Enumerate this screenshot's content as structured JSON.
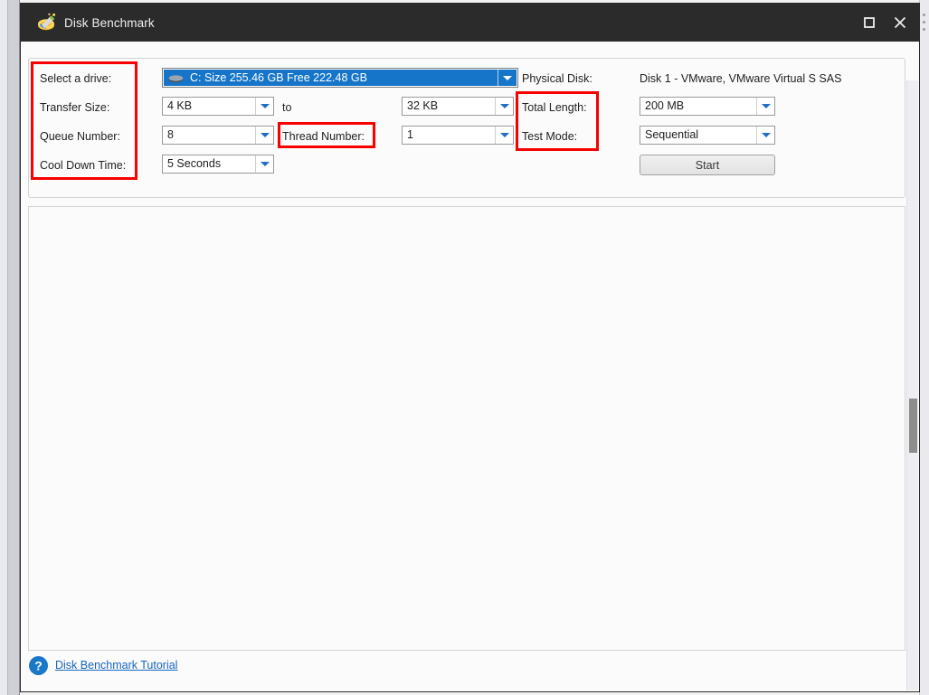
{
  "window": {
    "title": "Disk Benchmark",
    "app_icon": "disk-wand-icon",
    "controls": {
      "maximize_label": "Maximize",
      "close_label": "Close"
    }
  },
  "form": {
    "labels": {
      "select_drive": "Select a drive:",
      "transfer_size": "Transfer Size:",
      "queue_number": "Queue Number:",
      "cool_down_time": "Cool Down Time:",
      "to": "to",
      "thread_number": "Thread Number:",
      "physical_disk": "Physical Disk:",
      "total_length": "Total Length:",
      "test_mode": "Test Mode:"
    },
    "values": {
      "drive": "C:  Size 255.46 GB  Free 222.48 GB",
      "transfer_size_from": "4 KB",
      "transfer_size_to": "32 KB",
      "queue_number": "8",
      "thread_number": "1",
      "cool_down_time": "5 Seconds",
      "physical_disk": "Disk 1 - VMware, VMware Virtual S SAS",
      "total_length": "200 MB",
      "test_mode": "Sequential"
    },
    "start_button": "Start"
  },
  "footer": {
    "help_icon": "question-mark-icon",
    "tutorial_link": "Disk Benchmark Tutorial"
  },
  "annotations": {
    "accent_red": "#f70000",
    "selection_blue": "#1675c8",
    "link_blue": "#1565c0",
    "titlebar_dark": "#2b2b2b"
  }
}
